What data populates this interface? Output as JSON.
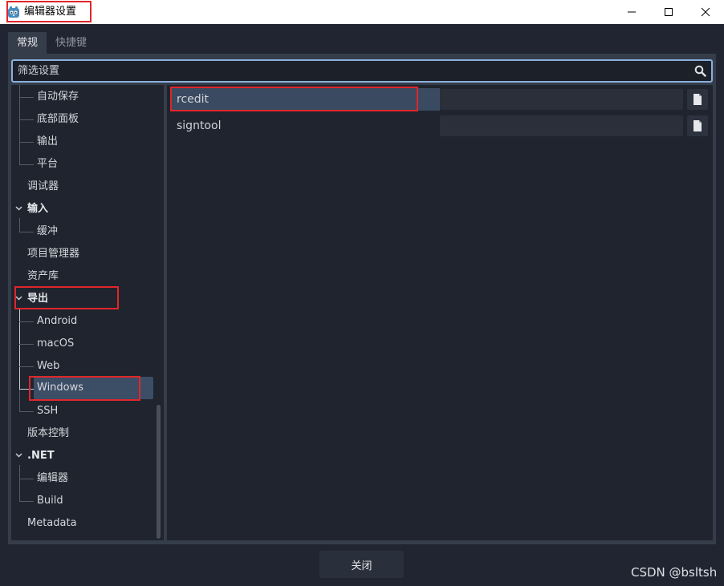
{
  "window": {
    "title": "编辑器设置",
    "icon": "godot-icon"
  },
  "tabs": [
    {
      "label": "常规",
      "active": true
    },
    {
      "label": "快捷键",
      "active": false
    }
  ],
  "search": {
    "placeholder": "筛选设置",
    "icon": "search-icon"
  },
  "tree": {
    "items": [
      {
        "label": "自动保存"
      },
      {
        "label": "底部面板"
      },
      {
        "label": "输出"
      },
      {
        "label": "平台"
      },
      {
        "label": "调试器"
      },
      {
        "label": "输入"
      },
      {
        "label": "缓冲"
      },
      {
        "label": "项目管理器"
      },
      {
        "label": "资产库"
      },
      {
        "label": "导出"
      },
      {
        "label": "Android"
      },
      {
        "label": "macOS"
      },
      {
        "label": "Web"
      },
      {
        "label": "Windows"
      },
      {
        "label": "SSH"
      },
      {
        "label": "版本控制"
      },
      {
        "label": ".NET"
      },
      {
        "label": "编辑器"
      },
      {
        "label": "Build"
      },
      {
        "label": "Metadata"
      }
    ]
  },
  "properties": [
    {
      "name": "rcedit",
      "value": ""
    },
    {
      "name": "signtool",
      "value": ""
    }
  ],
  "footer": {
    "close_label": "关闭"
  },
  "watermark": "CSDN @bsltsh",
  "colors": {
    "highlight": "#e0262b",
    "selection": "#3c4d66",
    "accent": "#8ab0dc"
  }
}
